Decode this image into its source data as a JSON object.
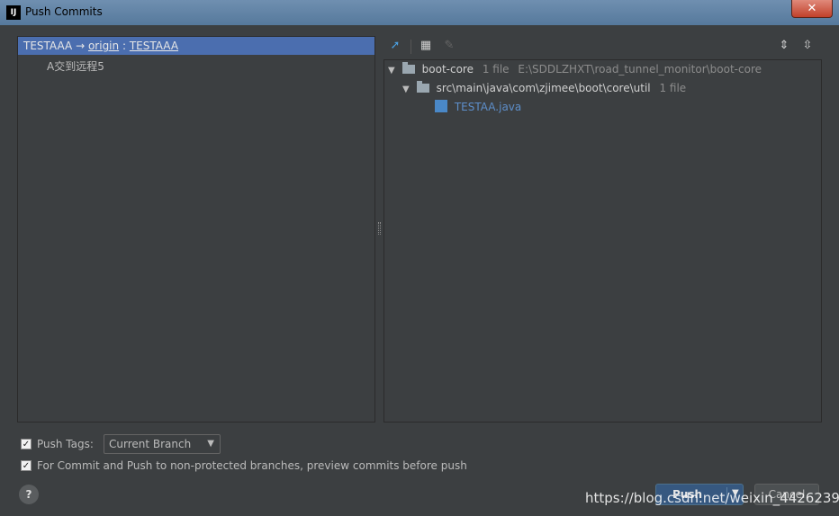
{
  "window": {
    "title": "Push Commits",
    "app_icon": "IJ",
    "close_glyph": "✕"
  },
  "commits_panel": {
    "branch_local": "TESTAAA",
    "arrow": "→",
    "remote": "origin",
    "separator": ":",
    "branch_remote": "TESTAAA",
    "commit_message": "A交到远程5"
  },
  "toolbar": {
    "icons": [
      "expand-diff-icon",
      "group-by-icon",
      "edit-icon",
      "expand-all-icon",
      "collapse-all-icon"
    ]
  },
  "changes_tree": {
    "module": {
      "name": "boot-core",
      "count": "1 file",
      "path": "E:\\SDDLZHXT\\road_tunnel_monitor\\boot-core"
    },
    "package": {
      "name": "src\\main\\java\\com\\zjimee\\boot\\core\\util",
      "count": "1 file"
    },
    "file": {
      "name": "TESTAA.java"
    }
  },
  "options": {
    "push_tags_label": "Push Tags:",
    "push_tags_checked": true,
    "push_tags_value": "Current Branch",
    "preview_label": "For Commit and Push to non-protected branches, preview commits before push",
    "preview_checked": true
  },
  "buttons": {
    "help": "?",
    "push": "Push",
    "cancel": "Cancel"
  },
  "watermark": "https://blog.csdn.net/weixin_44262390"
}
